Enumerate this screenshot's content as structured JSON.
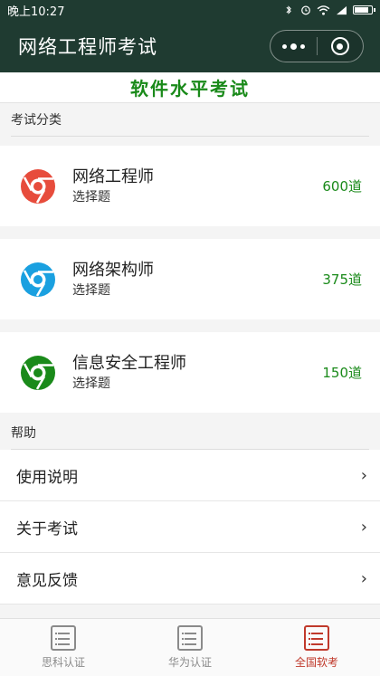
{
  "status_bar": {
    "time": "晚上10:27"
  },
  "navbar": {
    "title": "网络工程师考试"
  },
  "header": {
    "title": "软件水平考试"
  },
  "exam_section": {
    "label": "考试分类",
    "items": [
      {
        "title": "网络工程师",
        "subtitle": "选择题",
        "count": "600道",
        "color": "#e74c3c"
      },
      {
        "title": "网络架构师",
        "subtitle": "选择题",
        "count": "375道",
        "color": "#1aa0e0"
      },
      {
        "title": "信息安全工程师",
        "subtitle": "选择题",
        "count": "150道",
        "color": "#1a8a1a"
      }
    ]
  },
  "help_section": {
    "label": "帮助",
    "items": [
      {
        "label": "使用说明"
      },
      {
        "label": "关于考试"
      },
      {
        "label": "意见反馈"
      }
    ]
  },
  "tabbar": {
    "items": [
      {
        "label": "思科认证",
        "active": false
      },
      {
        "label": "华为认证",
        "active": false
      },
      {
        "label": "全国软考",
        "active": true
      }
    ],
    "active_color": "#c0392b"
  },
  "colors": {
    "brand": "#1f3b31",
    "accent_green": "#1a8a1a"
  }
}
